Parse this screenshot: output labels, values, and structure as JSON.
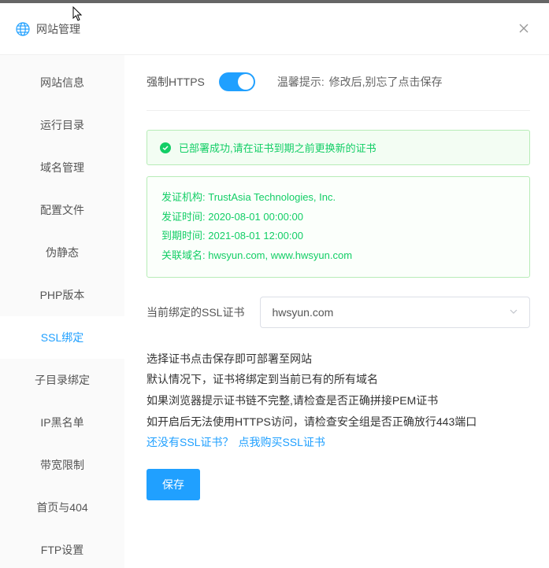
{
  "header": {
    "title": "网站管理"
  },
  "sidebar": {
    "items": [
      {
        "label": "网站信息"
      },
      {
        "label": "运行目录"
      },
      {
        "label": "域名管理"
      },
      {
        "label": "配置文件"
      },
      {
        "label": "伪静态"
      },
      {
        "label": "PHP版本"
      },
      {
        "label": "SSL绑定"
      },
      {
        "label": "子目录绑定"
      },
      {
        "label": "IP黑名单"
      },
      {
        "label": "带宽限制"
      },
      {
        "label": "首页与404"
      },
      {
        "label": "FTP设置"
      }
    ],
    "active_index": 6
  },
  "https_row": {
    "label": "强制HTTPS",
    "enabled": true,
    "tip_label": "温馨提示:",
    "tip_text": "修改后,别忘了点击保存"
  },
  "success_alert": {
    "text": "已部署成功,请在证书到期之前更换新的证书"
  },
  "cert_info": {
    "issuer_label": "发证机构:",
    "issuer_value": "TrustAsia Technologies, Inc.",
    "issued_label": "发证时间:",
    "issued_value": "2020-08-01 00:00:00",
    "expire_label": "到期时间:",
    "expire_value": "2021-08-01 12:00:00",
    "domains_label": "关联域名:",
    "domains_value": "hwsyun.com, www.hwsyun.com"
  },
  "select_row": {
    "label": "当前绑定的SSL证书",
    "value": "hwsyun.com"
  },
  "desc": {
    "line1": "选择证书点击保存即可部署至网站",
    "line2": "默认情况下，证书将绑定到当前已有的所有域名",
    "line3": "如果浏览器提示证书链不完整,请检查是否正确拼接PEM证书",
    "line4": "如开启后无法使用HTTPS访问，请检查安全组是否正确放行443端口",
    "question": "还没有SSL证书？",
    "link": "点我购买SSL证书"
  },
  "save_button": "保存"
}
